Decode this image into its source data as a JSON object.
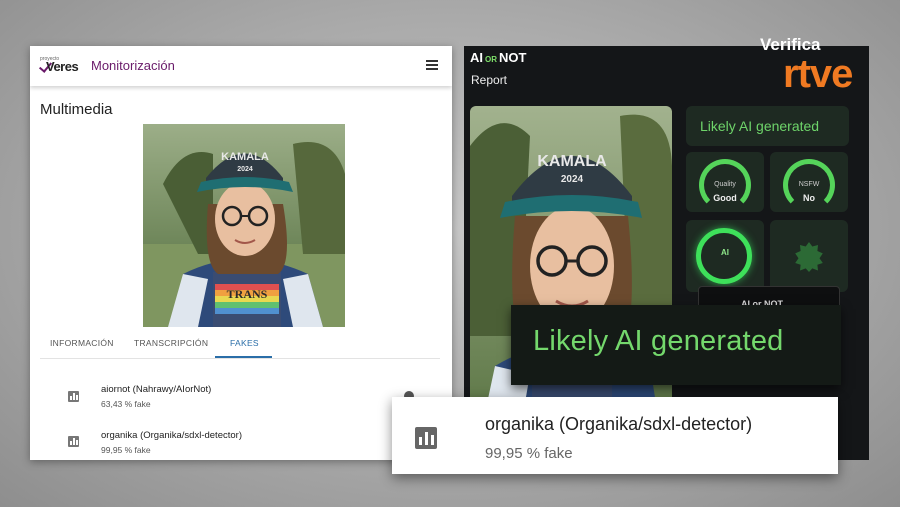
{
  "left_app": {
    "logo_small": "proyecto",
    "logo_text": "Veres",
    "title": "Monitorización",
    "section_title": "Multimedia",
    "tabs": [
      {
        "label": "INFORMACIÓN"
      },
      {
        "label": "TRANSCRIPCIÓN"
      },
      {
        "label": "FAKES",
        "active": true
      }
    ],
    "results": [
      {
        "name": "aiornot (Nahrawy/AIorNot)",
        "score": "63,43 % fake"
      },
      {
        "name": "organika (Organika/sdxl-detector)",
        "score": "99,95 % fake"
      }
    ],
    "photo_cap_text": "KAMALA",
    "photo_cap_subtext": "2024",
    "photo_shirt_text": "TRANS"
  },
  "aiornot": {
    "brand_ai": "AI",
    "brand_or": "OR",
    "brand_not": "NOT",
    "report_label": "Report",
    "verdict": "Likely AI generated",
    "quality_label": "Quality",
    "quality_value": "Good",
    "nsfw_label": "NSFW",
    "nsfw_value": "No",
    "ring_label": "AI",
    "small_box_text": "AI or NOT"
  },
  "zoom": {
    "verdict": "Likely AI generated",
    "result_name": "organika (Organika/sdxl-detector)",
    "result_score": "99,95 % fake"
  },
  "brand": {
    "verifica": "Verifica",
    "rtve": "rtve"
  },
  "colors": {
    "accent_purple": "#6a1b6a",
    "tab_active": "#2a6ea8",
    "ai_green": "#6ed46a",
    "rtve_orange": "#f07a22"
  }
}
